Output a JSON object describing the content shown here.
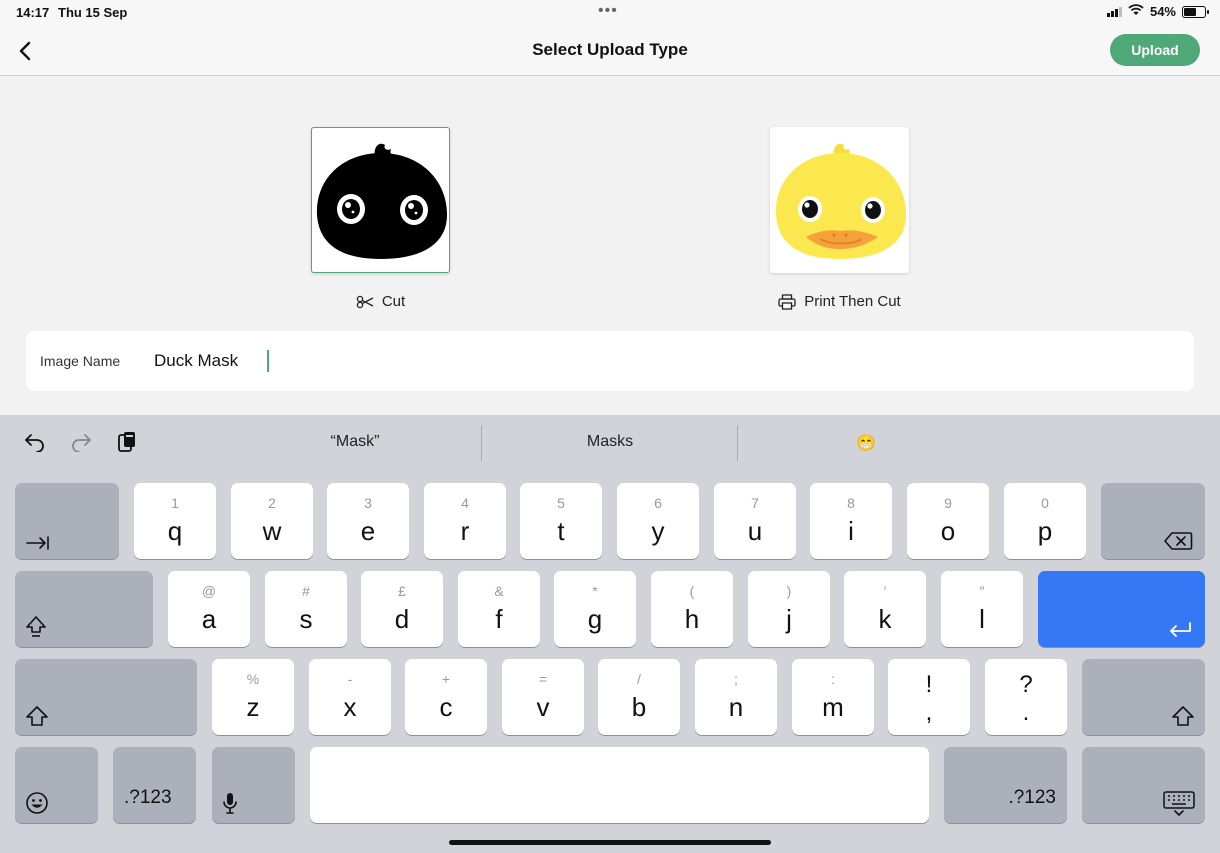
{
  "status": {
    "time": "14:17",
    "date": "Thu 15 Sep",
    "battery": "54%",
    "dots": "•••"
  },
  "nav": {
    "title": "Select Upload Type",
    "upload_label": "Upload"
  },
  "options": [
    {
      "label": "Cut",
      "icon": "scissors-icon",
      "selected": true
    },
    {
      "label": "Print Then Cut",
      "icon": "printer-icon",
      "selected": false
    }
  ],
  "image_name": {
    "label": "Image Name",
    "value": "Duck Mask"
  },
  "suggestions": [
    "“Mask”",
    "Masks",
    "😁"
  ],
  "keyboard": {
    "row1": [
      {
        "hint": "1",
        "char": "q"
      },
      {
        "hint": "2",
        "char": "w"
      },
      {
        "hint": "3",
        "char": "e"
      },
      {
        "hint": "4",
        "char": "r"
      },
      {
        "hint": "5",
        "char": "t"
      },
      {
        "hint": "6",
        "char": "y"
      },
      {
        "hint": "7",
        "char": "u"
      },
      {
        "hint": "8",
        "char": "i"
      },
      {
        "hint": "9",
        "char": "o"
      },
      {
        "hint": "0",
        "char": "p"
      }
    ],
    "row2": [
      {
        "hint": "@",
        "char": "a"
      },
      {
        "hint": "#",
        "char": "s"
      },
      {
        "hint": "£",
        "char": "d"
      },
      {
        "hint": "&",
        "char": "f"
      },
      {
        "hint": "*",
        "char": "g"
      },
      {
        "hint": "(",
        "char": "h"
      },
      {
        "hint": ")",
        "char": "j"
      },
      {
        "hint": "′",
        "char": "k"
      },
      {
        "hint": "″",
        "char": "l"
      }
    ],
    "row3": [
      {
        "hint": "%",
        "char": "z"
      },
      {
        "hint": "-",
        "char": "x"
      },
      {
        "hint": "+",
        "char": "c"
      },
      {
        "hint": "=",
        "char": "v"
      },
      {
        "hint": "/",
        "char": "b"
      },
      {
        "hint": ";",
        "char": "n"
      },
      {
        "hint": ":",
        "char": "m"
      }
    ],
    "punct1": {
      "top": "!",
      "bottom": ","
    },
    "punct2": {
      "top": "?",
      "bottom": "."
    },
    "numbers_label": ".?123"
  }
}
